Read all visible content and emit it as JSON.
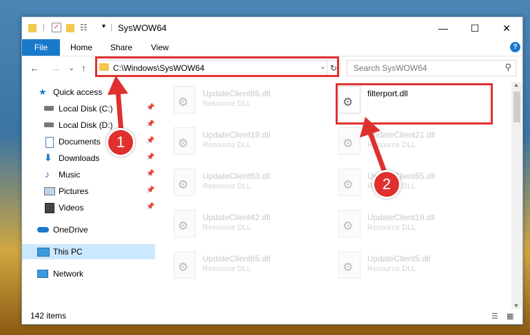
{
  "window": {
    "title": "SysWOW64",
    "minimize_glyph": "—",
    "maximize_glyph": "☐",
    "close_glyph": "✕"
  },
  "ribbon": {
    "file": "File",
    "home": "Home",
    "share": "Share",
    "view": "View",
    "help_glyph": "?"
  },
  "nav": {
    "back_glyph": "←",
    "forward_glyph": "→",
    "recent_glyph": "⌄",
    "up_glyph": "↑",
    "address_path": "C:\\Windows\\SysWOW64",
    "address_dropdown_glyph": "⌄",
    "refresh_glyph": "↻",
    "search_placeholder": "Search SysWOW64",
    "search_glyph": "⚲"
  },
  "sidebar": {
    "items": [
      {
        "label": "Quick access",
        "icon": "star-icon"
      },
      {
        "label": "Local Disk (C:)",
        "icon": "drive-icon",
        "pinned": true
      },
      {
        "label": "Local Disk (D:)",
        "icon": "drive-icon",
        "pinned": true
      },
      {
        "label": "Documents",
        "icon": "document-icon",
        "pinned": true
      },
      {
        "label": "Downloads",
        "icon": "download-icon",
        "pinned": true
      },
      {
        "label": "Music",
        "icon": "music-icon",
        "pinned": true
      },
      {
        "label": "Pictures",
        "icon": "pictures-icon",
        "pinned": true
      },
      {
        "label": "Videos",
        "icon": "video-icon",
        "pinned": true
      },
      {
        "label": "OneDrive",
        "icon": "cloud-icon"
      },
      {
        "label": "This PC",
        "icon": "computer-icon",
        "selected": true
      },
      {
        "label": "Network",
        "icon": "network-icon"
      }
    ],
    "pin_glyph": "📌"
  },
  "files": [
    {
      "name": "UpdateClient65.dll",
      "type": "Resource DLL"
    },
    {
      "name": "filterport.dll",
      "type": "",
      "highlight": true
    },
    {
      "name": "UpdateClient19.dll",
      "type": "Resource DLL"
    },
    {
      "name": "UpdateClient21.dll",
      "type": "Resource DLL"
    },
    {
      "name": "UpdateClient63.dll",
      "type": "Resource DLL"
    },
    {
      "name": "UpdateClient65.dll",
      "type": "Resource DLL"
    },
    {
      "name": "UpdateClient42.dll",
      "type": "Resource DLL"
    },
    {
      "name": "UpdateClient19.dll",
      "type": "Resource DLL"
    },
    {
      "name": "UpdateClient65.dll",
      "type": "Resource DLL"
    },
    {
      "name": "UpdateClient5.dll",
      "type": "Resource DLL"
    }
  ],
  "status": {
    "item_count": "142 items"
  },
  "annotations": {
    "step1": "1",
    "step2": "2",
    "highlight_color": "#e0302e"
  },
  "colors": {
    "accent": "#1979ca",
    "selection": "#cce8ff"
  }
}
